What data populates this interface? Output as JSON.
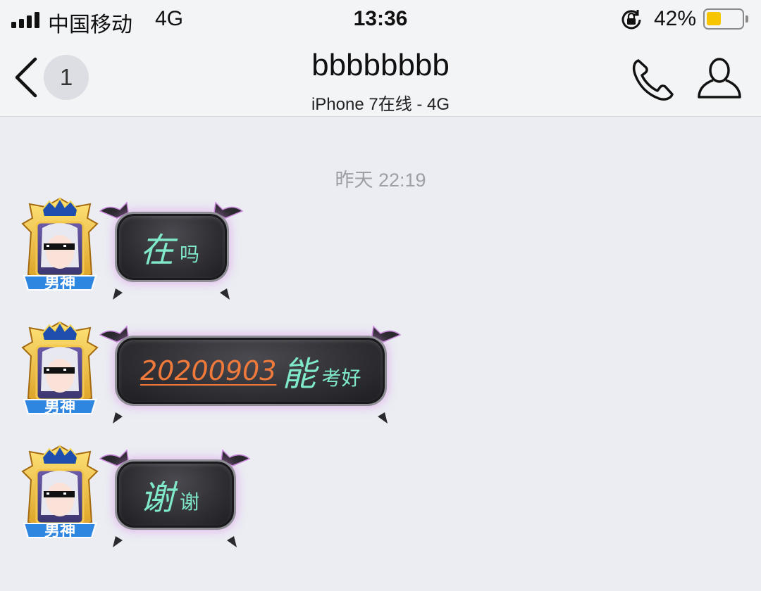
{
  "status_bar": {
    "carrier": "中国移动",
    "network": "4G",
    "time": "13:36",
    "battery_percent": "42%",
    "battery_level": 0.42,
    "battery_color": "#f7c400",
    "icons": [
      "signal-icon",
      "orientation-lock-icon",
      "battery-icon"
    ]
  },
  "nav": {
    "back_icon": "chevron-left-icon",
    "unread_count": "1",
    "title": "bbbbbbbb",
    "subtitle": "iPhone 7在线 - 4G",
    "call_icon": "phone-icon",
    "profile_icon": "person-icon"
  },
  "chat": {
    "timestamp": "昨天 22:19",
    "accent_text_color": "#7fe9c9",
    "link_color": "#f07a3c",
    "messages": [
      {
        "avatar_badge": "男神",
        "big": "在",
        "small": "吗"
      },
      {
        "avatar_badge": "男神",
        "link": "20200903",
        "big": "能",
        "small": "考好"
      },
      {
        "avatar_badge": "男神",
        "big": "谢",
        "small": "谢"
      }
    ]
  }
}
